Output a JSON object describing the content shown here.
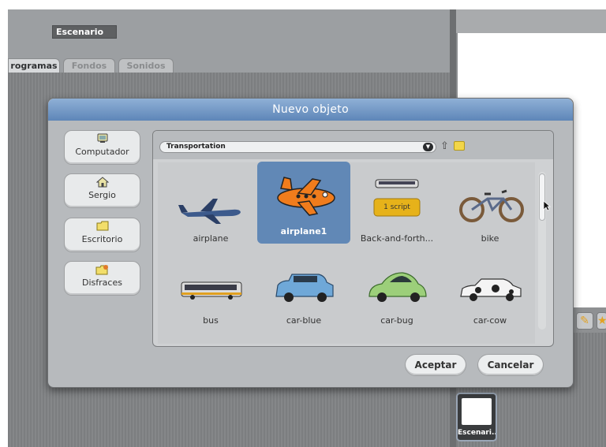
{
  "background": {
    "sprite_name": "Escenario",
    "tabs": [
      "Programas",
      "Fondos",
      "Sonidos"
    ],
    "tab_programas_visible": "rogramas",
    "thumbnail_label": "Escenari..."
  },
  "dialog": {
    "title": "Nuevo objeto",
    "locations": [
      {
        "label": "Computador",
        "icon": "computer-icon"
      },
      {
        "label": "Sergio",
        "icon": "home-icon"
      },
      {
        "label": "Escritorio",
        "icon": "folder-icon"
      },
      {
        "label": "Disfraces",
        "icon": "costumes-folder-icon"
      }
    ],
    "folder": "Transportation",
    "items": [
      {
        "label": "airplane",
        "selected": false
      },
      {
        "label": "airplane1",
        "selected": true
      },
      {
        "label": "Back-and-forth...",
        "selected": false,
        "badge": "1 script"
      },
      {
        "label": "bike",
        "selected": false
      },
      {
        "label": "bus",
        "selected": false
      },
      {
        "label": "car-blue",
        "selected": false
      },
      {
        "label": "car-bug",
        "selected": false
      },
      {
        "label": "car-cow",
        "selected": false
      }
    ],
    "ok_label": "Aceptar",
    "cancel_label": "Cancelar"
  },
  "colors": {
    "titlebar": "#6f94c3",
    "selected": "#6188b6",
    "dialog_bg": "#b7babd"
  }
}
